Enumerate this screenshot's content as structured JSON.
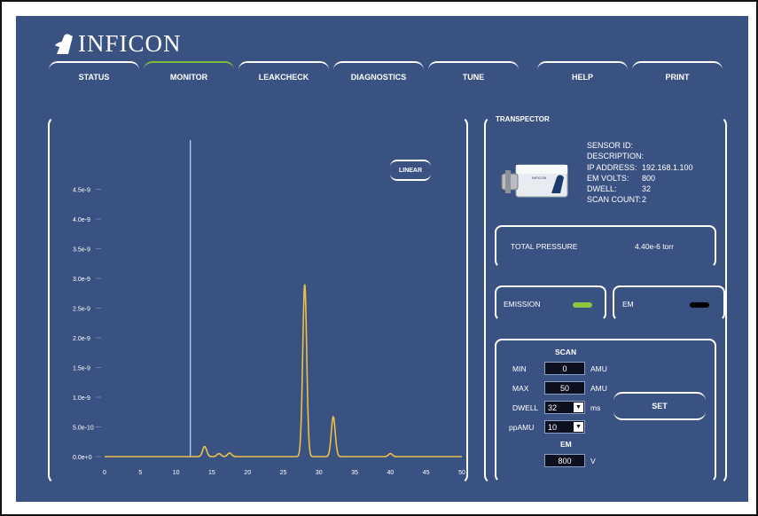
{
  "brand": {
    "name": "INFICON"
  },
  "tabs": [
    {
      "label": "STATUS",
      "active": false
    },
    {
      "label": "MONITOR",
      "active": true
    },
    {
      "label": "LEAKCHECK",
      "active": false
    },
    {
      "label": "DIAGNOSTICS",
      "active": false
    },
    {
      "label": "TUNE",
      "active": false
    },
    {
      "label": "HELP",
      "active": false
    },
    {
      "label": "PRINT",
      "active": false
    }
  ],
  "chart": {
    "mode_button": "LINEAR"
  },
  "chart_data": {
    "type": "line",
    "y_ticks": [
      "0.0e+0",
      "5.0e-10",
      "1.0e-9",
      "1.5e-9",
      "2.0e-9",
      "2.5e-9",
      "3.0e-9",
      "3.5e-9",
      "4.0e-9",
      "4.5e-9"
    ],
    "x_ticks": [
      "0",
      "5",
      "10",
      "15",
      "20",
      "25",
      "30",
      "35",
      "40",
      "45",
      "50"
    ],
    "xlim": [
      0,
      50
    ],
    "ylim": [
      0,
      5e-09
    ],
    "grid": false,
    "marker_x": 12,
    "series": [
      {
        "color": "#e8c24a",
        "peaks": [
          {
            "x": 14,
            "y": 1.7e-10
          },
          {
            "x": 16,
            "y": 5e-11
          },
          {
            "x": 17.5,
            "y": 6e-11
          },
          {
            "x": 28,
            "y": 2.9e-09
          },
          {
            "x": 32,
            "y": 6.7e-10
          },
          {
            "x": 40,
            "y": 5e-11
          }
        ]
      }
    ]
  },
  "transpector": {
    "title": "TRANSPECTOR",
    "rows": [
      {
        "k": "SENSOR ID:",
        "v": ""
      },
      {
        "k": "DESCRIPTION:",
        "v": ""
      },
      {
        "k": "IP ADDRESS:",
        "v": "192.168.1.100"
      },
      {
        "k": "EM VOLTS:",
        "v": "800"
      },
      {
        "k": "DWELL:",
        "v": "32"
      },
      {
        "k": "SCAN COUNT:",
        "v": "2"
      }
    ],
    "total_pressure_label": "TOTAL PRESSURE",
    "total_pressure_value": "4.40e-6 torr",
    "emission_label": "EMISSION",
    "em_label": "EM",
    "emission_color": "#8cc63f",
    "em_color": "#000000"
  },
  "scan": {
    "title": "SCAN",
    "min_label": "MIN",
    "min_value": "0",
    "max_label": "MAX",
    "max_value": "50",
    "amu": "AMU",
    "dwell_label": "DWELL",
    "dwell_value": "32",
    "ms": "ms",
    "ppamu_label": "ppAMU",
    "ppamu_value": "10",
    "em_title": "EM",
    "em_value": "800",
    "volts": "V",
    "set_label": "SET"
  }
}
